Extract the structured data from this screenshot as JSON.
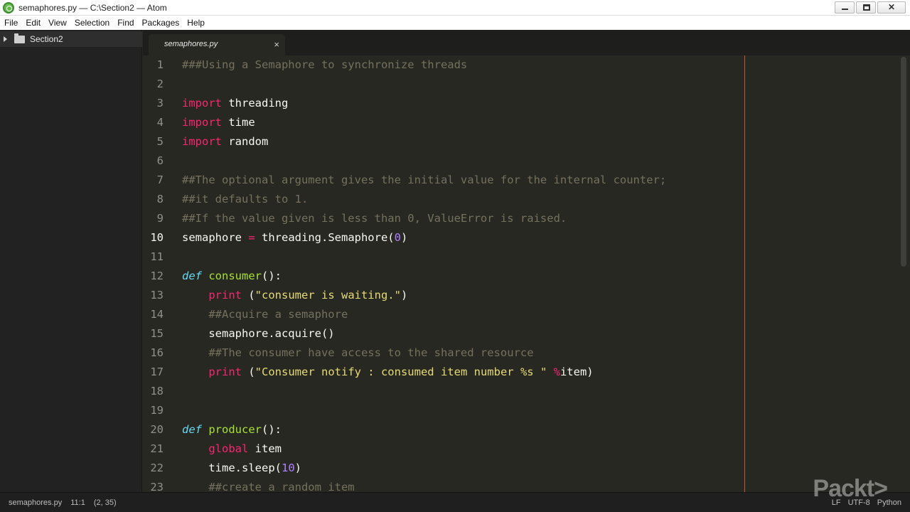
{
  "window": {
    "title": "semaphores.py — C:\\Section2 — Atom",
    "controls": [
      "minimize",
      "maximize",
      "close"
    ],
    "close_glyph": "✕"
  },
  "menu": [
    "File",
    "Edit",
    "View",
    "Selection",
    "Find",
    "Packages",
    "Help"
  ],
  "tree_view": {
    "root_label": "Section2",
    "icons": [
      "chevron-right-icon",
      "folder-icon"
    ]
  },
  "tab": {
    "label": "semaphores.py",
    "close_glyph": "×"
  },
  "editor": {
    "active_line": 10,
    "syntax_colors": {
      "comment": "#75715e",
      "keyword": "#f92672",
      "def": "#66d9ef",
      "function": "#a6e22e",
      "string": "#e6db74",
      "number": "#ae81ff",
      "text": "#f8f8f2"
    },
    "lines": [
      {
        "n": "1",
        "tokens": [
          {
            "t": "###Using a Semaphore to synchronize threads",
            "c": "comment"
          }
        ]
      },
      {
        "n": "2",
        "tokens": []
      },
      {
        "n": "3",
        "tokens": [
          {
            "t": "import",
            "c": "keyword"
          },
          {
            "t": " threading",
            "c": ""
          }
        ]
      },
      {
        "n": "4",
        "tokens": [
          {
            "t": "import",
            "c": "keyword"
          },
          {
            "t": " time",
            "c": ""
          }
        ]
      },
      {
        "n": "5",
        "tokens": [
          {
            "t": "import",
            "c": "keyword"
          },
          {
            "t": " random",
            "c": ""
          }
        ]
      },
      {
        "n": "6",
        "tokens": []
      },
      {
        "n": "7",
        "tokens": [
          {
            "t": "##The optional argument gives the initial value for the internal counter;",
            "c": "comment"
          }
        ]
      },
      {
        "n": "8",
        "tokens": [
          {
            "t": "##it defaults to 1.",
            "c": "comment"
          }
        ]
      },
      {
        "n": "9",
        "tokens": [
          {
            "t": "##If the value given is less than 0, ValueError is raised.",
            "c": "comment"
          }
        ]
      },
      {
        "n": "10",
        "tokens": [
          {
            "t": "semaphore ",
            "c": ""
          },
          {
            "t": "=",
            "c": "keyword"
          },
          {
            "t": " threading.Semaphore(",
            "c": ""
          },
          {
            "t": "0",
            "c": "number"
          },
          {
            "t": ")",
            "c": ""
          }
        ]
      },
      {
        "n": "11",
        "tokens": []
      },
      {
        "n": "12",
        "tokens": [
          {
            "t": "def",
            "c": "def"
          },
          {
            "t": " ",
            "c": ""
          },
          {
            "t": "consumer",
            "c": "function"
          },
          {
            "t": "():",
            "c": ""
          }
        ]
      },
      {
        "n": "13",
        "tokens": [
          {
            "t": "    ",
            "c": ""
          },
          {
            "t": "print",
            "c": "keyword"
          },
          {
            "t": " (",
            "c": ""
          },
          {
            "t": "\"consumer is waiting.\"",
            "c": "string"
          },
          {
            "t": ")",
            "c": ""
          }
        ]
      },
      {
        "n": "14",
        "tokens": [
          {
            "t": "    ",
            "c": ""
          },
          {
            "t": "##Acquire a semaphore",
            "c": "comment"
          }
        ]
      },
      {
        "n": "15",
        "tokens": [
          {
            "t": "    semaphore.acquire()",
            "c": ""
          }
        ]
      },
      {
        "n": "16",
        "tokens": [
          {
            "t": "    ",
            "c": ""
          },
          {
            "t": "##The consumer have access to the shared resource",
            "c": "comment"
          }
        ]
      },
      {
        "n": "17",
        "tokens": [
          {
            "t": "    ",
            "c": ""
          },
          {
            "t": "print",
            "c": "keyword"
          },
          {
            "t": " (",
            "c": ""
          },
          {
            "t": "\"Consumer notify : consumed item number %s \"",
            "c": "string"
          },
          {
            "t": " ",
            "c": ""
          },
          {
            "t": "%",
            "c": "keyword"
          },
          {
            "t": "item)",
            "c": ""
          }
        ]
      },
      {
        "n": "18",
        "tokens": []
      },
      {
        "n": "19",
        "tokens": []
      },
      {
        "n": "20",
        "tokens": [
          {
            "t": "def",
            "c": "def"
          },
          {
            "t": " ",
            "c": ""
          },
          {
            "t": "producer",
            "c": "function"
          },
          {
            "t": "():",
            "c": ""
          }
        ]
      },
      {
        "n": "21",
        "tokens": [
          {
            "t": "    ",
            "c": ""
          },
          {
            "t": "global",
            "c": "keyword"
          },
          {
            "t": " item",
            "c": ""
          }
        ]
      },
      {
        "n": "22",
        "tokens": [
          {
            "t": "    time.sleep(",
            "c": ""
          },
          {
            "t": "10",
            "c": "number"
          },
          {
            "t": ")",
            "c": ""
          }
        ]
      },
      {
        "n": "23",
        "tokens": [
          {
            "t": "    ",
            "c": ""
          },
          {
            "t": "##create a random item",
            "c": "comment"
          }
        ]
      }
    ]
  },
  "status_bar": {
    "file": "semaphores.py",
    "cursor": "11:1",
    "selection": "(2, 35)",
    "line_ending": "LF",
    "encoding": "UTF-8",
    "grammar": "Python"
  },
  "watermark": "Packt>"
}
